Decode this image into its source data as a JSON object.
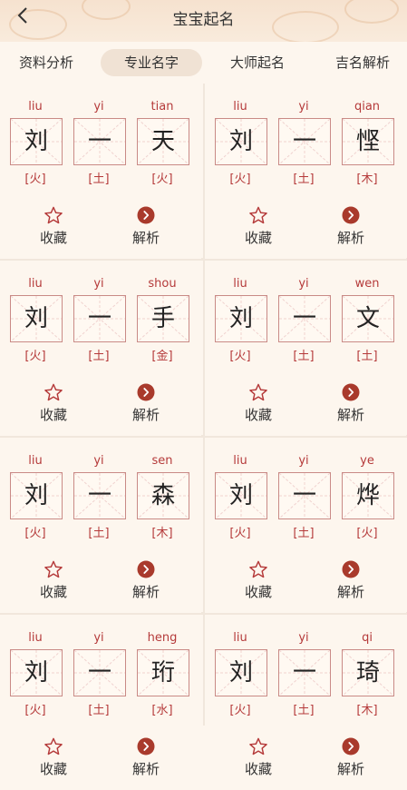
{
  "header": {
    "title": "宝宝起名"
  },
  "tabs": [
    {
      "label": "资料分析",
      "active": false
    },
    {
      "label": "专业名字",
      "active": true
    },
    {
      "label": "大师起名",
      "active": false
    },
    {
      "label": "吉名解析",
      "active": false
    }
  ],
  "actions": {
    "favorite_label": "收藏",
    "analyze_label": "解析"
  },
  "cards": [
    {
      "chars": [
        {
          "pinyin": "liu",
          "char": "刘",
          "element": "[火]"
        },
        {
          "pinyin": "yi",
          "char": "一",
          "element": "[土]"
        },
        {
          "pinyin": "tian",
          "char": "天",
          "element": "[火]"
        }
      ]
    },
    {
      "chars": [
        {
          "pinyin": "liu",
          "char": "刘",
          "element": "[火]"
        },
        {
          "pinyin": "yi",
          "char": "一",
          "element": "[土]"
        },
        {
          "pinyin": "qian",
          "char": "悭",
          "element": "[木]"
        }
      ]
    },
    {
      "chars": [
        {
          "pinyin": "liu",
          "char": "刘",
          "element": "[火]"
        },
        {
          "pinyin": "yi",
          "char": "一",
          "element": "[土]"
        },
        {
          "pinyin": "shou",
          "char": "手",
          "element": "[金]"
        }
      ]
    },
    {
      "chars": [
        {
          "pinyin": "liu",
          "char": "刘",
          "element": "[火]"
        },
        {
          "pinyin": "yi",
          "char": "一",
          "element": "[土]"
        },
        {
          "pinyin": "wen",
          "char": "文",
          "element": "[土]"
        }
      ]
    },
    {
      "chars": [
        {
          "pinyin": "liu",
          "char": "刘",
          "element": "[火]"
        },
        {
          "pinyin": "yi",
          "char": "一",
          "element": "[土]"
        },
        {
          "pinyin": "sen",
          "char": "森",
          "element": "[木]"
        }
      ]
    },
    {
      "chars": [
        {
          "pinyin": "liu",
          "char": "刘",
          "element": "[火]"
        },
        {
          "pinyin": "yi",
          "char": "一",
          "element": "[土]"
        },
        {
          "pinyin": "ye",
          "char": "烨",
          "element": "[火]"
        }
      ]
    },
    {
      "chars": [
        {
          "pinyin": "liu",
          "char": "刘",
          "element": "[火]"
        },
        {
          "pinyin": "yi",
          "char": "一",
          "element": "[土]"
        },
        {
          "pinyin": "heng",
          "char": "珩",
          "element": "[水]"
        }
      ]
    },
    {
      "chars": [
        {
          "pinyin": "liu",
          "char": "刘",
          "element": "[火]"
        },
        {
          "pinyin": "yi",
          "char": "一",
          "element": "[土]"
        },
        {
          "pinyin": "qi",
          "char": "琦",
          "element": "[木]"
        }
      ]
    }
  ],
  "colors": {
    "accent": "#b53a3a",
    "background": "#fdf6ee",
    "active_tab_bg": "#f0e2d4",
    "analyze_icon": "#a93a2c"
  },
  "icons": {
    "back": "chevron-left-icon",
    "favorite": "star-outline-icon",
    "analyze": "chevron-right-circle-icon"
  }
}
